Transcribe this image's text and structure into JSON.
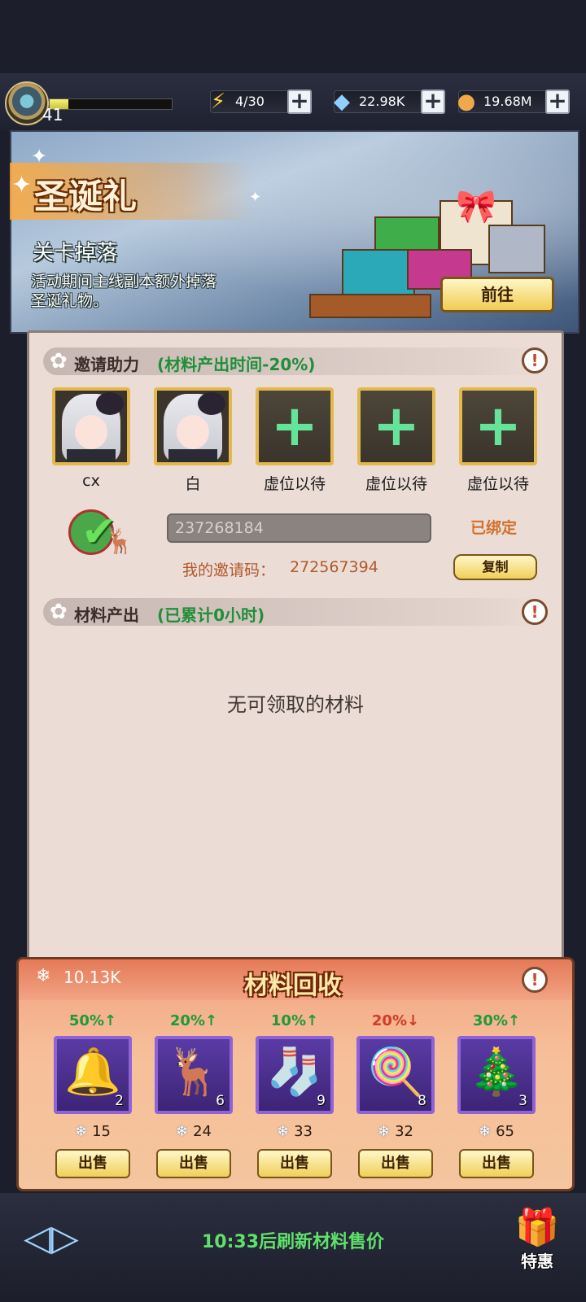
{
  "topbar": {
    "level": "41",
    "xp_fraction": 0.15,
    "energy": "4/30",
    "gems": "22.98K",
    "coins": "19.68M"
  },
  "banner": {
    "title": "圣诞礼",
    "subtitle": "关卡掉落",
    "description": "活动期间主线副本额外掉落圣诞礼物。",
    "goto_label": "前往"
  },
  "invite": {
    "title": "邀请助力",
    "note": "(材料产出时间-20%)",
    "slots": [
      {
        "name": "cx",
        "filled": true
      },
      {
        "name": "白",
        "filled": true
      },
      {
        "name": "虚位以待",
        "filled": false
      },
      {
        "name": "虚位以待",
        "filled": false
      },
      {
        "name": "虚位以待",
        "filled": false
      }
    ],
    "bound_code": "237268184",
    "bound_label": "已绑定",
    "my_code_label": "我的邀请码：",
    "my_code": "272567394",
    "copy_label": "复制"
  },
  "output": {
    "title": "材料产出",
    "note": "(已累计0小时)",
    "empty_text": "无可领取的材料"
  },
  "recycle": {
    "title": "材料回收",
    "total": "10.13K",
    "sell_label": "出售",
    "items": [
      {
        "icon": "bell-icon",
        "glyph": "🔔",
        "pct": "50%",
        "trend": "up",
        "count": "2",
        "price": "15"
      },
      {
        "icon": "reindeer-icon",
        "glyph": "🦌",
        "pct": "20%",
        "trend": "up",
        "count": "6",
        "price": "24"
      },
      {
        "icon": "stocking-icon",
        "glyph": "🧦",
        "pct": "10%",
        "trend": "up",
        "count": "9",
        "price": "33"
      },
      {
        "icon": "candy-cane-icon",
        "glyph": "🍭",
        "pct": "20%",
        "trend": "down",
        "count": "8",
        "price": "32"
      },
      {
        "icon": "wreath-icon",
        "glyph": "🎄",
        "pct": "30%",
        "trend": "up",
        "count": "3",
        "price": "65"
      }
    ]
  },
  "footer": {
    "refresh_text": "10:33后刷新材料售价",
    "special_label": "特惠"
  },
  "colors": {
    "accent_green": "#1e9a3a",
    "down_red": "#d23a2a",
    "panel_bg": "#ebddd6"
  }
}
